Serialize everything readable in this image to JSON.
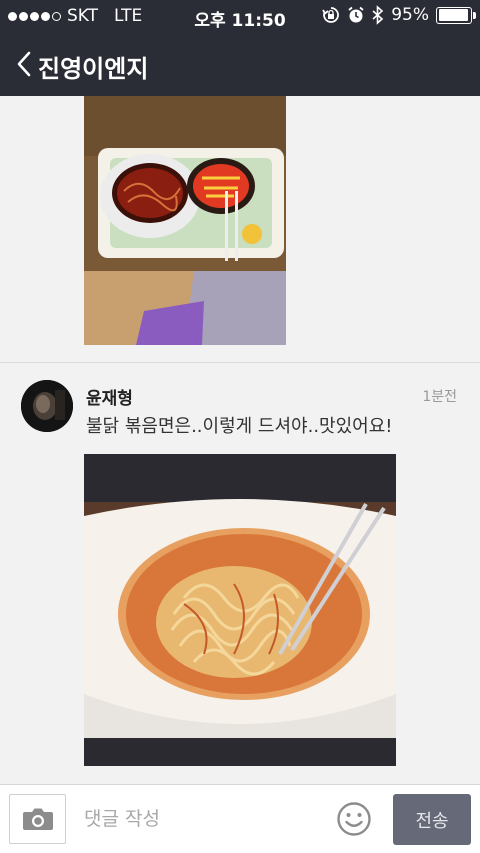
{
  "status_bar": {
    "carrier": "SKT",
    "network": "LTE",
    "time": "오후 11:50",
    "battery_percent": "95%",
    "battery_level": 0.95,
    "signal_bars_filled": 4,
    "signal_bars_total": 5
  },
  "header": {
    "back_icon": "chevron-left-icon",
    "title": "진영이엔지"
  },
  "comment": {
    "author": "윤재형",
    "time": "1분전",
    "text": "불닭 볶음면은..이렇게 드셔야..맛있어요!"
  },
  "composer": {
    "camera_icon": "camera-icon",
    "placeholder": "댓글 작성",
    "emoji_icon": "smiley-icon",
    "send_label": "전송"
  },
  "colors": {
    "header_bg": "#2b2d36",
    "feed_bg": "#f2f2f2",
    "send_bg": "#666a78"
  }
}
